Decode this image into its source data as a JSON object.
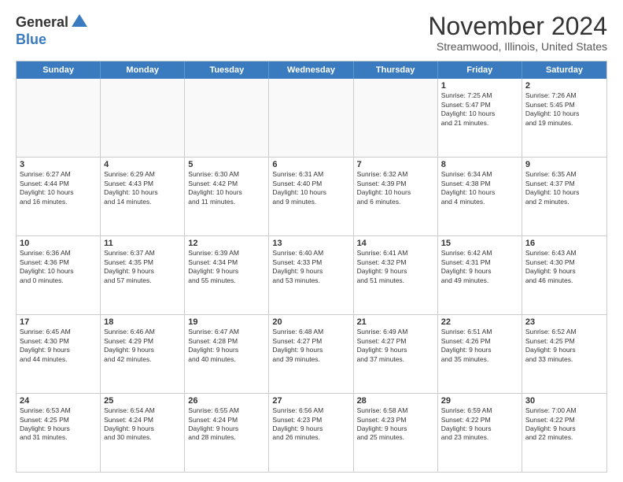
{
  "header": {
    "logo_general": "General",
    "logo_blue": "Blue",
    "month_title": "November 2024",
    "location": "Streamwood, Illinois, United States"
  },
  "calendar": {
    "days_of_week": [
      "Sunday",
      "Monday",
      "Tuesday",
      "Wednesday",
      "Thursday",
      "Friday",
      "Saturday"
    ],
    "weeks": [
      [
        {
          "day": "",
          "info": "",
          "empty": true
        },
        {
          "day": "",
          "info": "",
          "empty": true
        },
        {
          "day": "",
          "info": "",
          "empty": true
        },
        {
          "day": "",
          "info": "",
          "empty": true
        },
        {
          "day": "",
          "info": "",
          "empty": true
        },
        {
          "day": "1",
          "info": "Sunrise: 7:25 AM\nSunset: 5:47 PM\nDaylight: 10 hours\nand 21 minutes."
        },
        {
          "day": "2",
          "info": "Sunrise: 7:26 AM\nSunset: 5:45 PM\nDaylight: 10 hours\nand 19 minutes."
        }
      ],
      [
        {
          "day": "3",
          "info": "Sunrise: 6:27 AM\nSunset: 4:44 PM\nDaylight: 10 hours\nand 16 minutes."
        },
        {
          "day": "4",
          "info": "Sunrise: 6:29 AM\nSunset: 4:43 PM\nDaylight: 10 hours\nand 14 minutes."
        },
        {
          "day": "5",
          "info": "Sunrise: 6:30 AM\nSunset: 4:42 PM\nDaylight: 10 hours\nand 11 minutes."
        },
        {
          "day": "6",
          "info": "Sunrise: 6:31 AM\nSunset: 4:40 PM\nDaylight: 10 hours\nand 9 minutes."
        },
        {
          "day": "7",
          "info": "Sunrise: 6:32 AM\nSunset: 4:39 PM\nDaylight: 10 hours\nand 6 minutes."
        },
        {
          "day": "8",
          "info": "Sunrise: 6:34 AM\nSunset: 4:38 PM\nDaylight: 10 hours\nand 4 minutes."
        },
        {
          "day": "9",
          "info": "Sunrise: 6:35 AM\nSunset: 4:37 PM\nDaylight: 10 hours\nand 2 minutes."
        }
      ],
      [
        {
          "day": "10",
          "info": "Sunrise: 6:36 AM\nSunset: 4:36 PM\nDaylight: 10 hours\nand 0 minutes."
        },
        {
          "day": "11",
          "info": "Sunrise: 6:37 AM\nSunset: 4:35 PM\nDaylight: 9 hours\nand 57 minutes."
        },
        {
          "day": "12",
          "info": "Sunrise: 6:39 AM\nSunset: 4:34 PM\nDaylight: 9 hours\nand 55 minutes."
        },
        {
          "day": "13",
          "info": "Sunrise: 6:40 AM\nSunset: 4:33 PM\nDaylight: 9 hours\nand 53 minutes."
        },
        {
          "day": "14",
          "info": "Sunrise: 6:41 AM\nSunset: 4:32 PM\nDaylight: 9 hours\nand 51 minutes."
        },
        {
          "day": "15",
          "info": "Sunrise: 6:42 AM\nSunset: 4:31 PM\nDaylight: 9 hours\nand 49 minutes."
        },
        {
          "day": "16",
          "info": "Sunrise: 6:43 AM\nSunset: 4:30 PM\nDaylight: 9 hours\nand 46 minutes."
        }
      ],
      [
        {
          "day": "17",
          "info": "Sunrise: 6:45 AM\nSunset: 4:30 PM\nDaylight: 9 hours\nand 44 minutes."
        },
        {
          "day": "18",
          "info": "Sunrise: 6:46 AM\nSunset: 4:29 PM\nDaylight: 9 hours\nand 42 minutes."
        },
        {
          "day": "19",
          "info": "Sunrise: 6:47 AM\nSunset: 4:28 PM\nDaylight: 9 hours\nand 40 minutes."
        },
        {
          "day": "20",
          "info": "Sunrise: 6:48 AM\nSunset: 4:27 PM\nDaylight: 9 hours\nand 39 minutes."
        },
        {
          "day": "21",
          "info": "Sunrise: 6:49 AM\nSunset: 4:27 PM\nDaylight: 9 hours\nand 37 minutes."
        },
        {
          "day": "22",
          "info": "Sunrise: 6:51 AM\nSunset: 4:26 PM\nDaylight: 9 hours\nand 35 minutes."
        },
        {
          "day": "23",
          "info": "Sunrise: 6:52 AM\nSunset: 4:25 PM\nDaylight: 9 hours\nand 33 minutes."
        }
      ],
      [
        {
          "day": "24",
          "info": "Sunrise: 6:53 AM\nSunset: 4:25 PM\nDaylight: 9 hours\nand 31 minutes."
        },
        {
          "day": "25",
          "info": "Sunrise: 6:54 AM\nSunset: 4:24 PM\nDaylight: 9 hours\nand 30 minutes."
        },
        {
          "day": "26",
          "info": "Sunrise: 6:55 AM\nSunset: 4:24 PM\nDaylight: 9 hours\nand 28 minutes."
        },
        {
          "day": "27",
          "info": "Sunrise: 6:56 AM\nSunset: 4:23 PM\nDaylight: 9 hours\nand 26 minutes."
        },
        {
          "day": "28",
          "info": "Sunrise: 6:58 AM\nSunset: 4:23 PM\nDaylight: 9 hours\nand 25 minutes."
        },
        {
          "day": "29",
          "info": "Sunrise: 6:59 AM\nSunset: 4:22 PM\nDaylight: 9 hours\nand 23 minutes."
        },
        {
          "day": "30",
          "info": "Sunrise: 7:00 AM\nSunset: 4:22 PM\nDaylight: 9 hours\nand 22 minutes."
        }
      ]
    ]
  }
}
